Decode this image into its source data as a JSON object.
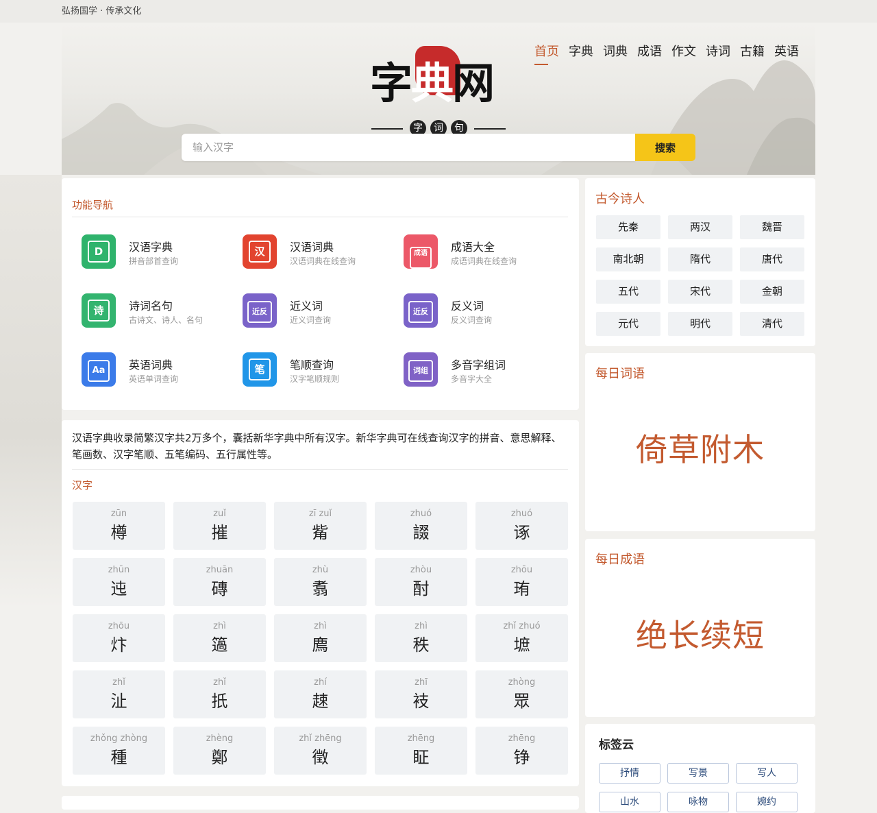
{
  "topbar": {
    "slogan": "弘扬国学 · 传承文化"
  },
  "logo": {
    "c1": "字",
    "c2": "典",
    "c3": "网",
    "sub": [
      "字",
      "词",
      "句"
    ]
  },
  "nav": [
    "首页",
    "字典",
    "词典",
    "成语",
    "作文",
    "诗词",
    "古籍",
    "英语"
  ],
  "search": {
    "placeholder": "输入汉字",
    "button": "搜索"
  },
  "tools": {
    "title": "功能导航",
    "items": [
      {
        "title": "汉语字典",
        "sub": "拼音部首查询",
        "icon_text": "D",
        "color": "#2fb36c"
      },
      {
        "title": "汉语词典",
        "sub": "汉语词典在线查询",
        "icon_text": "汉",
        "color": "#e2442f"
      },
      {
        "title": "成语大全",
        "sub": "成语词典在线查询",
        "icon_text": "成语",
        "color": "#ec5868"
      },
      {
        "title": "诗词名句",
        "sub": "古诗文、诗人、名句",
        "icon_text": "诗",
        "color": "#33b46f"
      },
      {
        "title": "近义词",
        "sub": "近义词查询",
        "icon_text": "近反",
        "color": "#7a63c9"
      },
      {
        "title": "反义词",
        "sub": "反义词查询",
        "icon_text": "近反",
        "color": "#7a63c9"
      },
      {
        "title": "英语词典",
        "sub": "英语单词查询",
        "icon_text": "Aa",
        "color": "#3b7be9"
      },
      {
        "title": "笔顺查询",
        "sub": "汉字笔顺规则",
        "icon_text": "笔",
        "color": "#2196e8"
      },
      {
        "title": "多音字组词",
        "sub": "多音字大全",
        "icon_text": "词组",
        "color": "#8062c6"
      }
    ]
  },
  "chars": {
    "intro": "汉语字典收录简繁汉字共2万多个，囊括新华字典中所有汉字。新华字典可在线查询汉字的拼音、意思解释、笔画数、汉字笔顺、五笔编码、五行属性等。",
    "title": "汉字",
    "items": [
      {
        "py": "zūn",
        "ch": "樽"
      },
      {
        "py": "zuǐ",
        "ch": "摧"
      },
      {
        "py": "zī zuǐ",
        "ch": "觜"
      },
      {
        "py": "zhuó",
        "ch": "諁"
      },
      {
        "py": "zhuó",
        "ch": "诼"
      },
      {
        "py": "zhūn",
        "ch": "迍"
      },
      {
        "py": "zhuān",
        "ch": "磚"
      },
      {
        "py": "zhù",
        "ch": "翥"
      },
      {
        "py": "zhòu",
        "ch": "酎"
      },
      {
        "py": "zhōu",
        "ch": "珛"
      },
      {
        "py": "zhōu",
        "ch": "炞"
      },
      {
        "py": "zhì",
        "ch": "簻"
      },
      {
        "py": "zhì",
        "ch": "廌"
      },
      {
        "py": "zhì",
        "ch": "秩"
      },
      {
        "py": "zhǐ zhuó",
        "ch": "墌"
      },
      {
        "py": "zhǐ",
        "ch": "沚"
      },
      {
        "py": "zhǐ",
        "ch": "扺"
      },
      {
        "py": "zhí",
        "ch": "趚"
      },
      {
        "py": "zhī",
        "ch": "衼"
      },
      {
        "py": "zhòng",
        "ch": "眾"
      },
      {
        "py": "zhǒng zhòng",
        "ch": "種"
      },
      {
        "py": "zhèng",
        "ch": "鄭"
      },
      {
        "py": "zhǐ zhēng",
        "ch": "徵"
      },
      {
        "py": "zhēng",
        "ch": "眐"
      },
      {
        "py": "zhēng",
        "ch": "铮"
      }
    ]
  },
  "poets": {
    "title": "古今诗人",
    "items": [
      "先秦",
      "两汉",
      "魏晋",
      "南北朝",
      "隋代",
      "唐代",
      "五代",
      "宋代",
      "金朝",
      "元代",
      "明代",
      "清代"
    ]
  },
  "daily_word": {
    "title": "每日词语",
    "value": "倚草附木"
  },
  "daily_idiom": {
    "title": "每日成语",
    "value": "绝长续短"
  },
  "tags": {
    "title": "标签云",
    "items": [
      "抒情",
      "写景",
      "写人",
      "山水",
      "咏物",
      "婉约"
    ]
  }
}
